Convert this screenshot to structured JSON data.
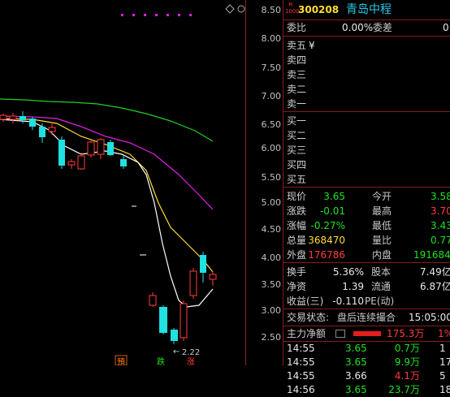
{
  "chart": {
    "price_ticks": [
      "8.50",
      "8.00",
      "7.50",
      "7.00",
      "6.50",
      "6.00",
      "5.50",
      "5.00",
      "4.50",
      "4.00",
      "3.50",
      "3.00",
      "2.50"
    ],
    "low_annotation": "2.22",
    "markers": [
      {
        "text": "預",
        "color": "#ff7a1a"
      },
      {
        "text": "跌",
        "color": "#20e020"
      },
      {
        "text": "涨",
        "color": "#ff3b3b"
      }
    ]
  },
  "header": {
    "badge_top": "R",
    "badge_bottom": "1000",
    "code": "300208",
    "name": "青岛中程"
  },
  "weibi": {
    "label1": "委比",
    "value1": "0.00%",
    "label2": "委差",
    "value2": "0"
  },
  "sell": [
    "卖五",
    "卖四",
    "卖三",
    "卖二",
    "卖一"
  ],
  "sell_extra": "¥",
  "buy": [
    "买一",
    "买二",
    "买三",
    "买四",
    "买五"
  ],
  "quote": [
    {
      "l1": "现价",
      "v1": "3.65",
      "c1": "g",
      "l2": "今开",
      "v2": "3.58",
      "c2": "g"
    },
    {
      "l1": "涨跌",
      "v1": "-0.01",
      "c1": "g",
      "l2": "最高",
      "v2": "3.70",
      "c2": "r"
    },
    {
      "l1": "涨幅",
      "v1": "-0.27%",
      "c1": "g",
      "l2": "最低",
      "v2": "3.43",
      "c2": "g"
    },
    {
      "l1": "总量",
      "v1": "368470",
      "c1": "y",
      "l2": "量比",
      "v2": "0.77",
      "c2": "g"
    },
    {
      "l1": "外盘",
      "v1": "176786",
      "c1": "r",
      "l2": "内盘",
      "v2": "191684",
      "c2": "g"
    }
  ],
  "stats": [
    {
      "l1": "换手",
      "v1": "5.36%",
      "l2": "股本",
      "v2": "7.49亿"
    },
    {
      "l1": "净资",
      "v1": "1.39",
      "l2": "流通",
      "v2": "6.87亿"
    },
    {
      "l1": "收益(三)",
      "v1": "-0.110",
      "l2": "PE(动)",
      "v2": ""
    }
  ],
  "trade_status": {
    "label": "交易状态:",
    "value": "盘后连续撮合",
    "time": "15:05:00"
  },
  "fund": {
    "label": "主力净额",
    "value": "175.3万",
    "pct": "1%"
  },
  "ticks": [
    {
      "time": "14:55",
      "price": "3.65",
      "pc": "g",
      "vol": "0.7万",
      "vc": "g",
      "n": "1"
    },
    {
      "time": "14:55",
      "price": "3.65",
      "pc": "g",
      "vol": "9.9万",
      "vc": "g",
      "n": "17"
    },
    {
      "time": "14:55",
      "price": "3.66",
      "pc": "w",
      "vol": "4.1万",
      "vc": "r",
      "n": "5"
    },
    {
      "time": "14:56",
      "price": "3.65",
      "pc": "g",
      "vol": "23.7万",
      "vc": "g",
      "n": "18"
    }
  ],
  "colors": {
    "up": "#ff3b3b",
    "down": "#20e0e0",
    "ma5": "#ffffff",
    "ma10": "#ffdd33",
    "ma20": "#e020e0",
    "ma60": "#20d020"
  }
}
